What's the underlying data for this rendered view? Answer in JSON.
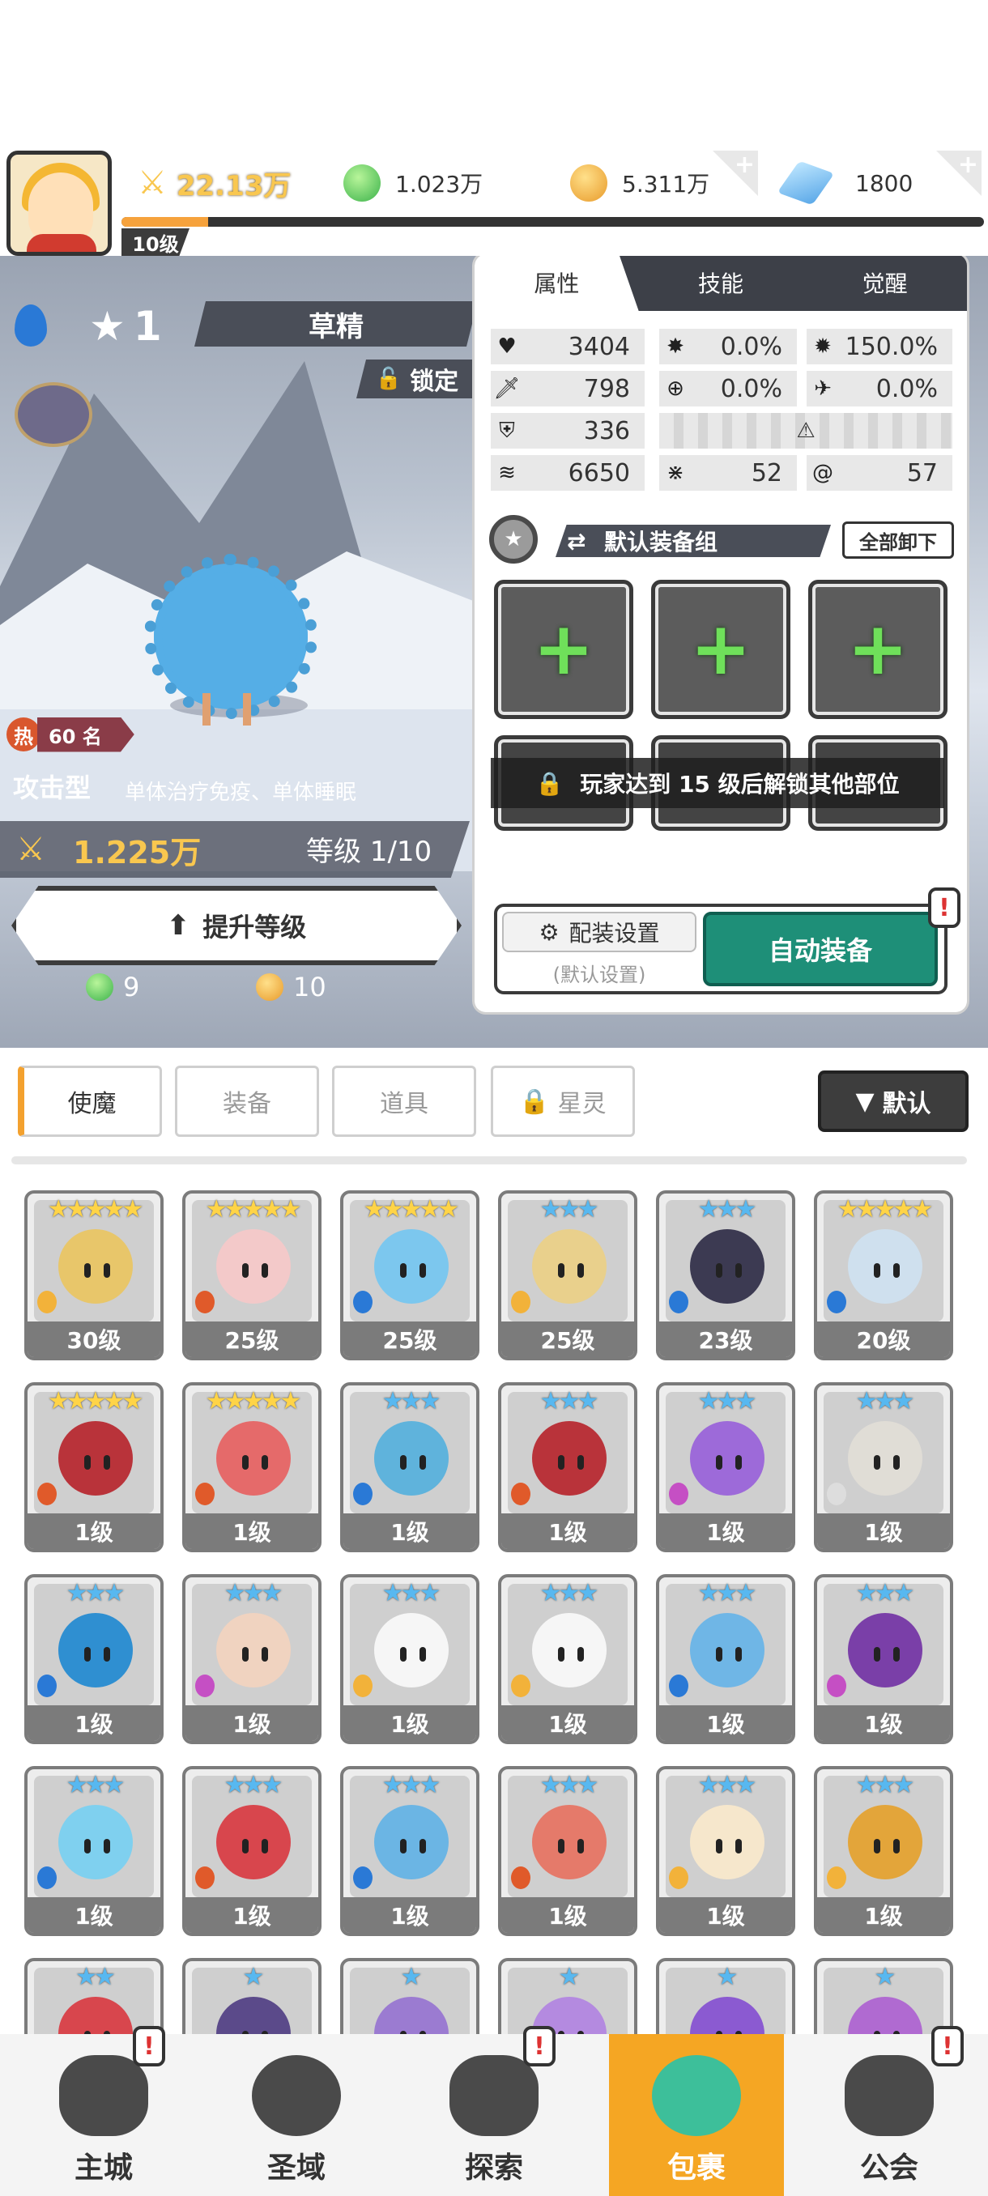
{
  "top": {
    "power": "22.13万",
    "green_gems": "1.023万",
    "gold": "5.311万",
    "diamonds": "1800",
    "player_level": "10级",
    "xp_fraction": 0.1,
    "plus": "+"
  },
  "hero": {
    "name": "草精",
    "stars": "1",
    "lock_label": "锁定",
    "hot_char": "热",
    "rank": "60 名",
    "type": "攻击型",
    "skill": "单体治疗免疫、单体睡眠",
    "power": "1.225万",
    "level": "等级 1/10",
    "upgrade_label": "提升等级",
    "cost_green": "9",
    "cost_gold": "10"
  },
  "panel": {
    "tabs": [
      "属性",
      "技能",
      "觉醒"
    ],
    "stats": {
      "hp": "3404",
      "crit": "0.0%",
      "crit_dmg": "150.0%",
      "atk": "798",
      "accuracy": "0.0%",
      "dodge": "0.0%",
      "def": "336",
      "speed": "6650",
      "s1": "52",
      "s2": "57"
    },
    "equip_set": "默认装备组",
    "unload_all": "全部卸下",
    "lock_message": "玩家达到 15 级后解锁其他部位",
    "config_label": "配装设置",
    "config_sub": "(默认设置)",
    "auto_equip": "自动装备",
    "alert": "!"
  },
  "filters": {
    "tabs": [
      "使魔",
      "装备",
      "道具",
      "星灵"
    ],
    "sort": "默认"
  },
  "cards": [
    {
      "stars": "★★★★★",
      "level": "30级"
    },
    {
      "stars": "★★★★★",
      "level": "25级"
    },
    {
      "stars": "★★★★★",
      "level": "25级"
    },
    {
      "stars": "★★★",
      "level": "25级"
    },
    {
      "stars": "★★★",
      "level": "23级"
    },
    {
      "stars": "★★★★★",
      "level": "20级"
    },
    {
      "stars": "★★★★★",
      "level": "1级"
    },
    {
      "stars": "★★★★★",
      "level": "1级"
    },
    {
      "stars": "★★★",
      "level": "1级"
    },
    {
      "stars": "★★★",
      "level": "1级"
    },
    {
      "stars": "★★★",
      "level": "1级"
    },
    {
      "stars": "★★★",
      "level": "1级"
    },
    {
      "stars": "★★★",
      "level": "1级"
    },
    {
      "stars": "★★★",
      "level": "1级"
    },
    {
      "stars": "★★★",
      "level": "1级"
    },
    {
      "stars": "★★★",
      "level": "1级"
    },
    {
      "stars": "★★★",
      "level": "1级"
    },
    {
      "stars": "★★★",
      "level": "1级"
    },
    {
      "stars": "★★★",
      "level": "1级"
    },
    {
      "stars": "★★★",
      "level": "1级"
    },
    {
      "stars": "★★★",
      "level": "1级"
    },
    {
      "stars": "★★★",
      "level": "1级"
    },
    {
      "stars": "★★★",
      "level": "1级"
    },
    {
      "stars": "★★★",
      "level": "1级"
    },
    {
      "stars": "★★",
      "level": ""
    },
    {
      "stars": "★",
      "level": ""
    },
    {
      "stars": "★",
      "level": ""
    },
    {
      "stars": "★",
      "level": ""
    },
    {
      "stars": "★",
      "level": ""
    },
    {
      "stars": "★",
      "level": ""
    }
  ],
  "nav": [
    "主城",
    "圣域",
    "探索",
    "包裹",
    "公会"
  ],
  "colors": {
    "accent": "#f5a623",
    "auto_button": "#1e8f78",
    "gold_text": "#f9c74f",
    "plus_green": "#6fe05a"
  },
  "icons": [
    "swords-icon",
    "green-gem-icon",
    "gold-coin-icon",
    "diamond-icon",
    "water-element-icon",
    "star-icon",
    "lock-icon",
    "heart-icon",
    "sword-icon",
    "shield-icon",
    "speed-icon",
    "gear-icon",
    "swap-icon"
  ]
}
